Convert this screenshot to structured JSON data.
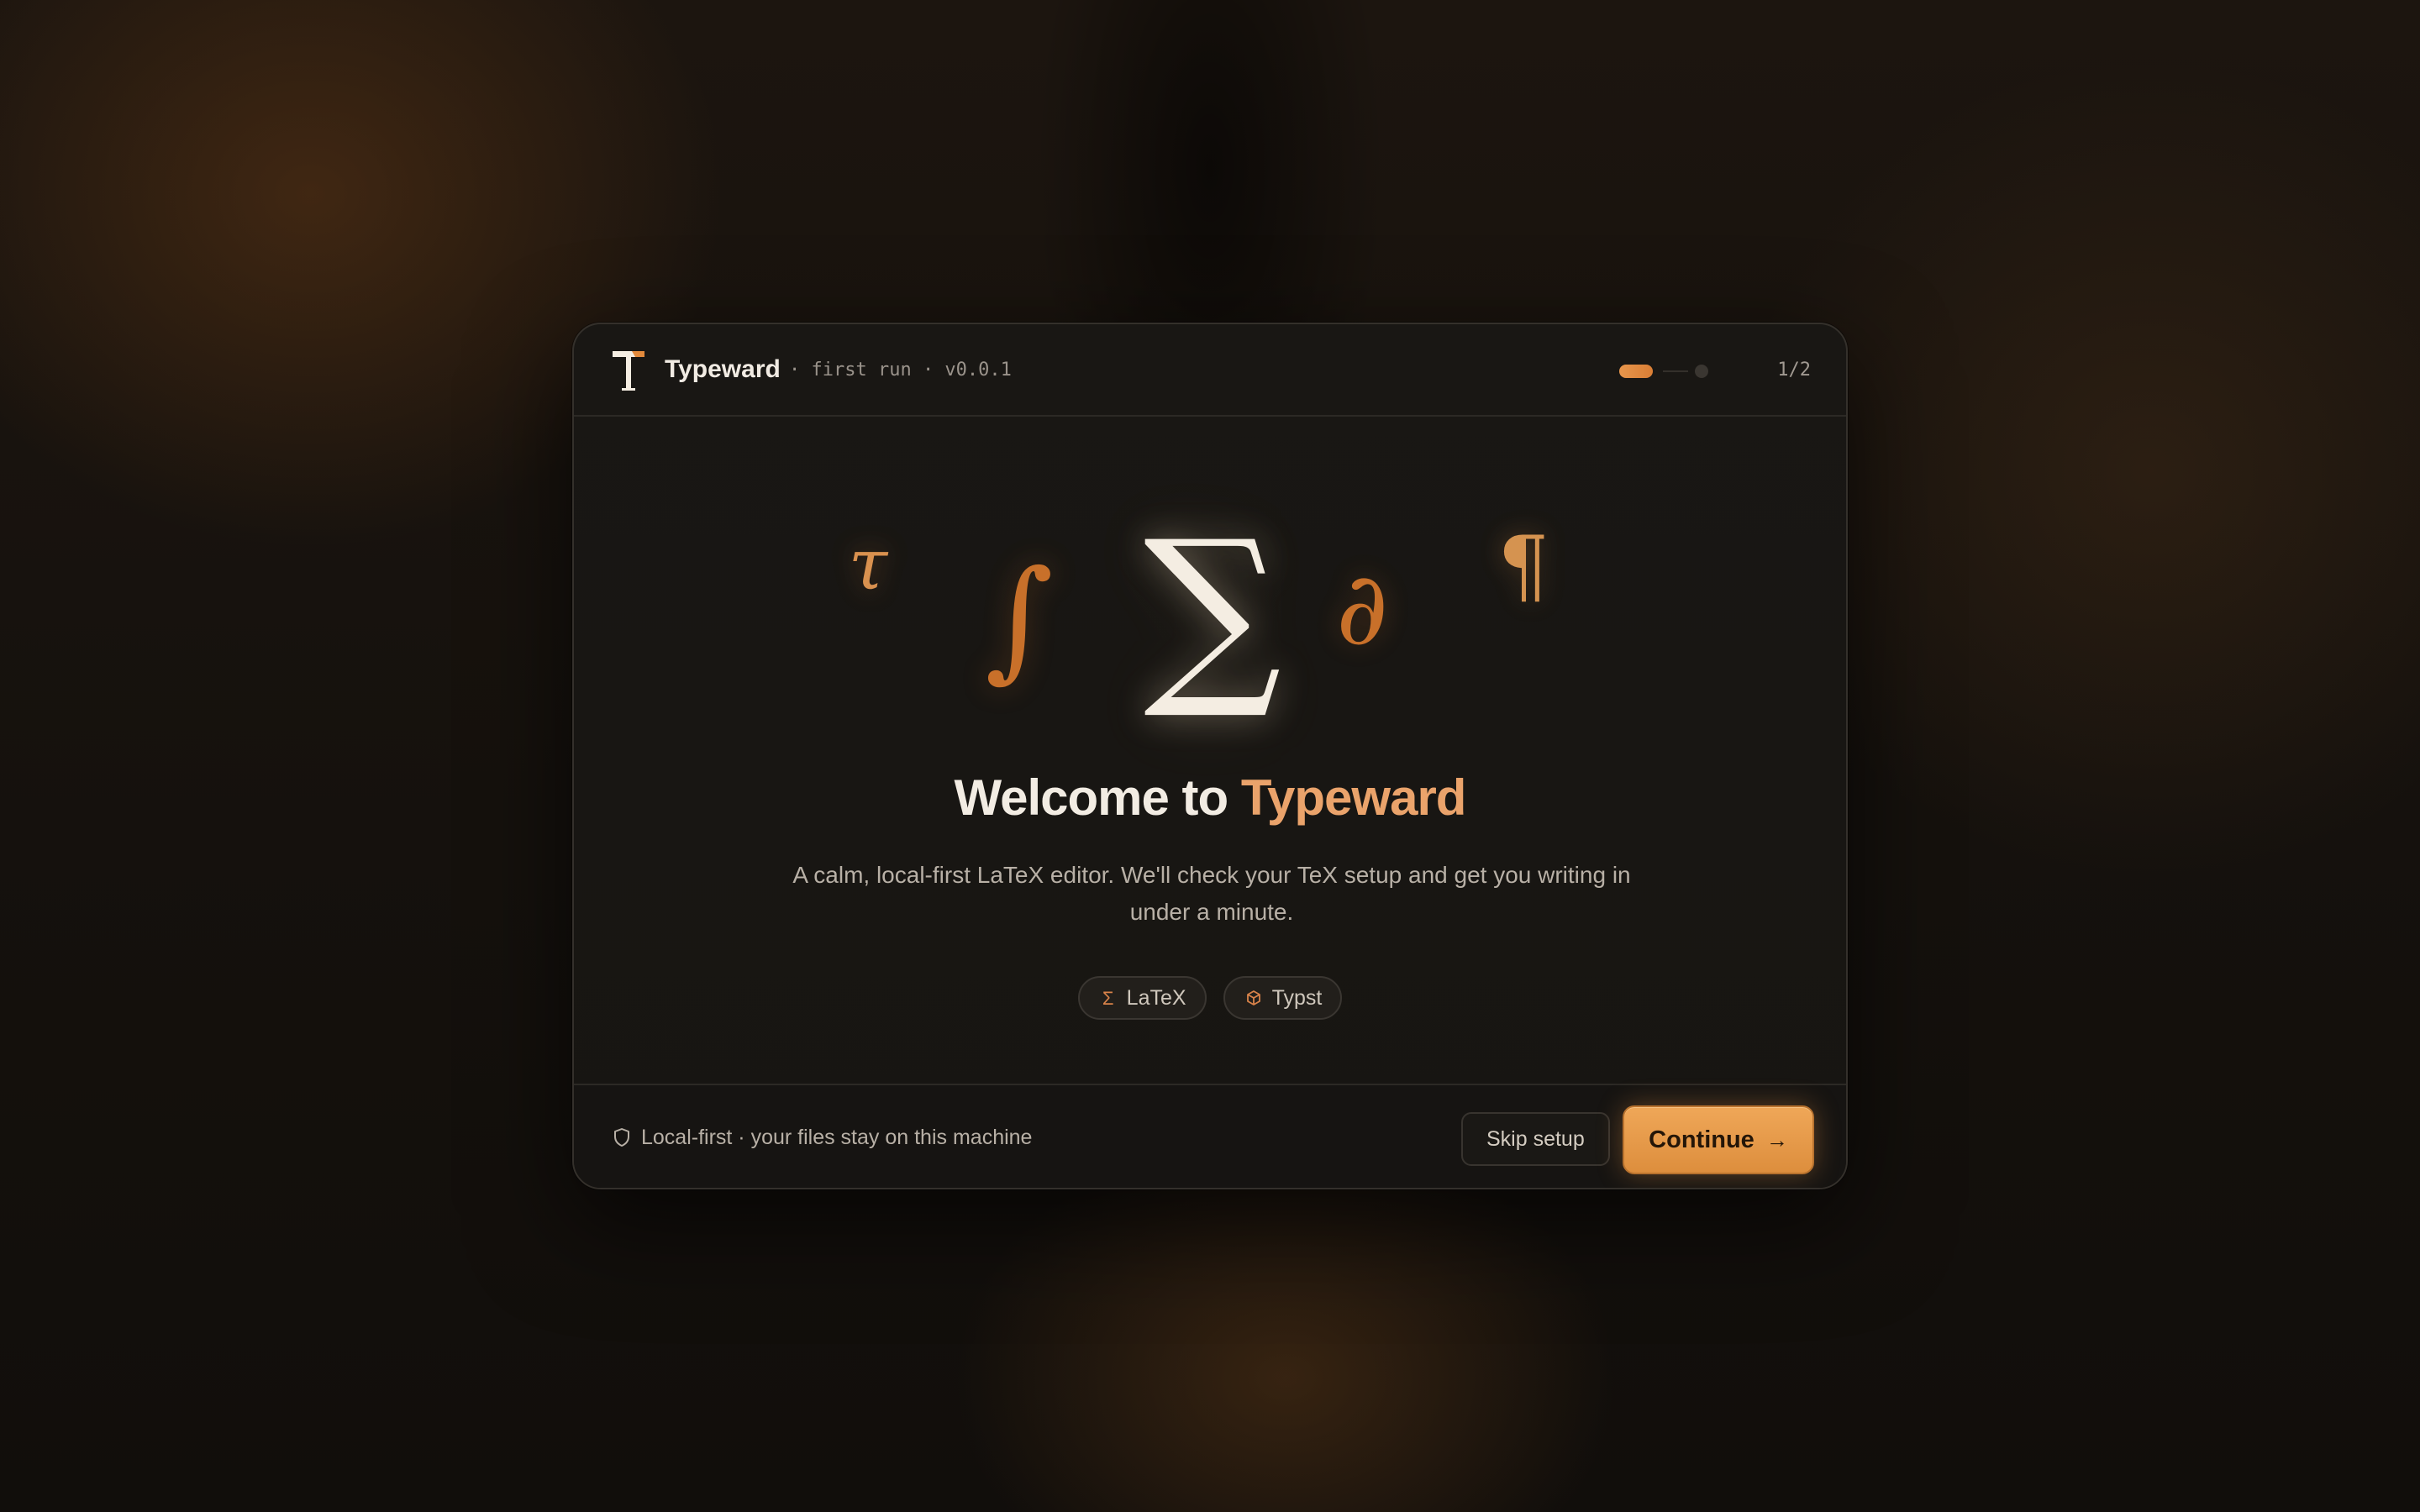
{
  "header": {
    "app_name": "Typeward",
    "meta": "· first run · v0.0.1",
    "step_count": "1/2"
  },
  "hero": {
    "glyphs": {
      "tau": "τ",
      "integral": "∫",
      "sigma": "∑",
      "partial": "∂",
      "pilcrow": "¶"
    },
    "title_prefix": "Welcome to ",
    "title_accent": "Typeward",
    "subtitle": "A calm, local-first LaTeX editor. We'll check your TeX setup and get you writing in under a minute."
  },
  "chips": [
    {
      "icon": "sigma-icon",
      "glyph": "Σ",
      "label": "LaTeX"
    },
    {
      "icon": "cube-icon",
      "glyph": "⬡",
      "label": "Typst"
    }
  ],
  "footer": {
    "note": "Local-first · your files stay on this machine",
    "skip_label": "Skip setup",
    "continue_label": "Continue",
    "continue_arrow": "→"
  },
  "colors": {
    "accent": "#eaa36b",
    "button": "#e89a4a",
    "background": "#0d0c0b",
    "card": "#181613"
  },
  "progress": {
    "current_step": 1,
    "total_steps": 2
  }
}
